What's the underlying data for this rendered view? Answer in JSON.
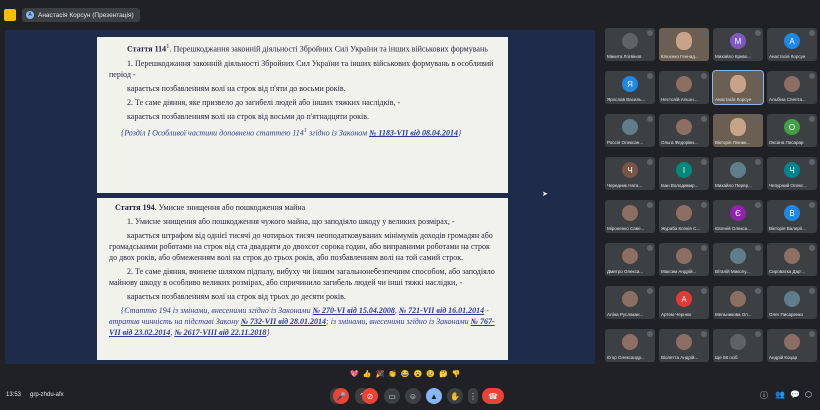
{
  "topbar": {
    "presenter_label": "Анастасія Корсун (Презентація)"
  },
  "slide": {
    "art114": {
      "heading_bold": "Стаття 114",
      "heading_sup": "1",
      "heading_rest": ". Перешкоджання законній діяльності Збройних Сил України та інших військових формувань",
      "p1": "1. Перешкоджання законній діяльності Збройних Сил України та інших військових формувань в особливий період -",
      "p2": "карається позбавленням волі на строк від п'яти до восьми років.",
      "p3": "2. Те саме діяння, яке призвело до загибелі людей або інших тяжких наслідків, -",
      "p4": "карається позбавленням волі на строк від восьми до п'ятнадцяти років.",
      "note_text": "{Розділ I Особливої частини доповнено статтею 114",
      "note_sup": "1",
      "note_mid": " згідно із Законом ",
      "note_link": "№ 1183-VII від 08.04.2014",
      "note_end": "}"
    },
    "art194": {
      "heading_bold": "Стаття 194.",
      "heading_rest": " Умисне знищення або пошкодження майна",
      "p1": "1. Умисне знищення або пошкодження чужого майна, що заподіяло шкоду у великих розмірах, -",
      "p2": "карається штрафом від однієї тисячі до чотирьох тисяч неоподатковуваних мінімумів доходів громадян або громадськими роботами на строк від ста двадцяти до двохсот сорока годин, або виправними роботами на строк до двох років, або обмеженням волі на строк до трьох років, або позбавленням волі на той самий строк.",
      "p3": "2. Те саме діяння, вчинене шляхом підпалу, вибуху чи іншим загальнонебезпечним способом, або заподіяло майнову шкоду в особливо великих розмірах, або спричинило загибель людей чи інші тяжкі наслідки, -",
      "p4": "карається позбавленням волі на строк від трьох до десяти років.",
      "note_a": "{Статтю 194 із змінами, внесеними згідно із Законами ",
      "link1": "№ 270-VI від 15.04.2008",
      "sep1": ", ",
      "link2": "№ 721-VII від 16.01.2014",
      "note_b": " - втратив чинність на підставі Закону ",
      "link3": "№ 732-VII від 28.01.2014",
      "note_c": "; із змінами, внесеними згідно із Законами ",
      "link4": "№ 767-VII від 23.02.2014",
      "sep2": ", ",
      "link5": "№ 2617-VIII від 22.11.2018",
      "note_end": "}"
    }
  },
  "participants": [
    {
      "name": "Микита Логвінов",
      "initial": "",
      "color": "#5f6368",
      "video": false
    },
    {
      "name": "Клюєнко Геннад...",
      "initial": "",
      "color": "#7a6a5a",
      "video": true
    },
    {
      "name": "Михайло Криво...",
      "initial": "М",
      "color": "#7e57c2",
      "video": false
    },
    {
      "name": "Анастасія Корсун",
      "initial": "А",
      "color": "#1e88e5",
      "video": false
    },
    {
      "name": "Ярослав Василь...",
      "initial": "Я",
      "color": "#1e88e5",
      "video": false
    },
    {
      "name": "Нестолій Альон...",
      "initial": "",
      "color": "#8d6e63",
      "video": false
    },
    {
      "name": "Анастасія Корсун",
      "initial": "",
      "color": "#8a7a6a",
      "video": true,
      "active": true
    },
    {
      "name": "Альбіна Спелта...",
      "initial": "",
      "color": "#8d6e63",
      "video": false
    },
    {
      "name": "Россія Олексан...",
      "initial": "",
      "color": "#607d8b",
      "video": false
    },
    {
      "name": "Ольга Федорівн...",
      "initial": "",
      "color": "#8d6e63",
      "video": false
    },
    {
      "name": "Вікторія Лінник...",
      "initial": "",
      "color": "#7a6a5a",
      "video": true
    },
    {
      "name": "Оксана Писарар",
      "initial": "О",
      "color": "#43a047",
      "video": false
    },
    {
      "name": "Чередник Ната...",
      "initial": "Ч",
      "color": "#795548",
      "video": false
    },
    {
      "name": "Іван Володимир...",
      "initial": "І",
      "color": "#00897b",
      "video": false
    },
    {
      "name": "Михайло Перер...",
      "initial": "",
      "color": "#607d8b",
      "video": false
    },
    {
      "name": "Чепурний Олекс...",
      "initial": "Ч",
      "color": "#00838f",
      "video": false
    },
    {
      "name": "Міроненко Саве...",
      "initial": "",
      "color": "#8d6e63",
      "video": false
    },
    {
      "name": "Жураба Ксенія С...",
      "initial": "",
      "color": "#8d6e63",
      "video": false
    },
    {
      "name": "Євгеній Олекса...",
      "initial": "Є",
      "color": "#8e24aa",
      "video": false
    },
    {
      "name": "Вікторія Валерії...",
      "initial": "В",
      "color": "#1e88e5",
      "video": false
    },
    {
      "name": "Дмитро Олекса...",
      "initial": "",
      "color": "#8d6e63",
      "video": false
    },
    {
      "name": "Максим Андрій...",
      "initial": "",
      "color": "#8d6e63",
      "video": false
    },
    {
      "name": "Віталій Миколу...",
      "initial": "",
      "color": "#607d8b",
      "video": false
    },
    {
      "name": "Сироватка Дар'...",
      "initial": "",
      "color": "#8d6e63",
      "video": false
    },
    {
      "name": "Аліна Руслакан...",
      "initial": "",
      "color": "#8d6e63",
      "video": false
    },
    {
      "name": "Артем Чернюк",
      "initial": "А",
      "color": "#e53935",
      "video": false
    },
    {
      "name": "Мельникова Ол...",
      "initial": "",
      "color": "#8d6e63",
      "video": false
    },
    {
      "name": "Олег Писаренко",
      "initial": "",
      "color": "#607d8b",
      "video": false
    },
    {
      "name": "Єгор Олександр...",
      "initial": "",
      "color": "#8d6e63",
      "video": false
    },
    {
      "name": "Віолетта Андрій...",
      "initial": "",
      "color": "#8d6e63",
      "video": false
    },
    {
      "name": "Ще 58 осіб",
      "initial": "",
      "color": "#5f6368",
      "video": false
    },
    {
      "name": "Андрій Коцар",
      "initial": "",
      "color": "#8d6e63",
      "video": false
    }
  ],
  "bottombar": {
    "time": "13:53",
    "meeting_code": "grp-zhdu-afx"
  },
  "emojis": [
    "💖",
    "👍",
    "🎉",
    "👏",
    "😂",
    "😮",
    "😢",
    "🤔",
    "👎"
  ]
}
